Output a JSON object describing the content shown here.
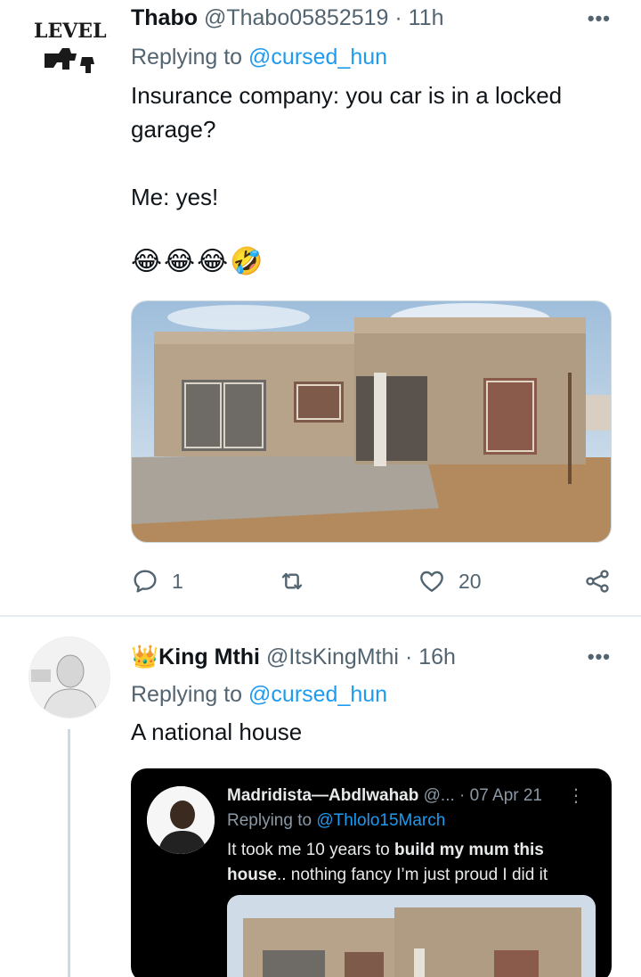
{
  "tweets": [
    {
      "author_name": "Thabo",
      "author_handle": "@Thabo05852519",
      "time": "· 11h",
      "more": "•••",
      "replying_prefix": "Replying to",
      "replying_handle": "@cursed_hun",
      "text": "Insurance company: you car is in a locked\ngarage?\n\nMe: yes!",
      "emoji": "😂😂😂🤣",
      "avatar_logo_text": "LEVELS",
      "actions": {
        "replies": "1",
        "retweets": "",
        "likes": "20"
      }
    },
    {
      "author_badge": "👑",
      "author_name": "King Mthi",
      "author_handle": "@ItsKingMthi",
      "time": "· 16h",
      "more": "•••",
      "replying_prefix": "Replying to",
      "replying_handle": "@cursed_hun",
      "text": "A national house",
      "quote": {
        "author_name": "Madridista—Abdlwahab",
        "author_handle": "@...",
        "time": "· 07 Apr 21",
        "more": "⋮",
        "replying_prefix": "Replying to",
        "replying_handle": "@Thlolo15March",
        "text_part1": "It took me 10 years to ",
        "text_bold1": "build my mum this house",
        "text_part2": ".. nothing fancy I’m just proud I did it"
      }
    }
  ],
  "colors": {
    "text_primary": "#0f1419",
    "text_secondary": "#536471",
    "link": "#1d9bf0",
    "divider": "#e6ecf0",
    "quote_bg": "#000000"
  }
}
